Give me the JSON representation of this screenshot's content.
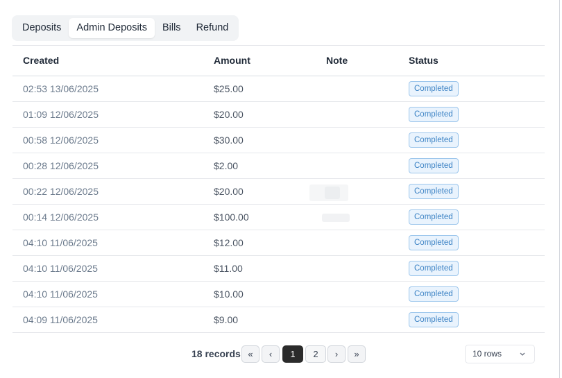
{
  "tabs": [
    {
      "label": "Deposits",
      "active": false
    },
    {
      "label": "Admin Deposits",
      "active": true
    },
    {
      "label": "Bills",
      "active": false
    },
    {
      "label": "Refund",
      "active": false
    }
  ],
  "table": {
    "headers": {
      "created": "Created",
      "amount": "Amount",
      "note": "Note",
      "status": "Status"
    },
    "rows": [
      {
        "created": "02:53 13/06/2025",
        "amount": "$25.00",
        "note": "",
        "status": "Completed"
      },
      {
        "created": "01:09 12/06/2025",
        "amount": "$20.00",
        "note": "",
        "status": "Completed"
      },
      {
        "created": "00:58 12/06/2025",
        "amount": "$30.00",
        "note": "",
        "status": "Completed"
      },
      {
        "created": "00:28 12/06/2025",
        "amount": "$2.00",
        "note": "",
        "status": "Completed"
      },
      {
        "created": "00:22 12/06/2025",
        "amount": "$20.00",
        "note": "",
        "status": "Completed"
      },
      {
        "created": "00:14 12/06/2025",
        "amount": "$100.00",
        "note": "",
        "status": "Completed"
      },
      {
        "created": "04:10 11/06/2025",
        "amount": "$12.00",
        "note": "",
        "status": "Completed"
      },
      {
        "created": "04:10 11/06/2025",
        "amount": "$11.00",
        "note": "",
        "status": "Completed"
      },
      {
        "created": "04:10 11/06/2025",
        "amount": "$10.00",
        "note": "",
        "status": "Completed"
      },
      {
        "created": "04:09 11/06/2025",
        "amount": "$9.00",
        "note": "",
        "status": "Completed"
      }
    ]
  },
  "pagination": {
    "records": "18 records",
    "first_icon": "«",
    "prev_icon": "‹",
    "pages": [
      "1",
      "2"
    ],
    "current_page": "1",
    "next_icon": "›",
    "last_icon": "»"
  },
  "rows_per_page": {
    "value": "10 rows",
    "chevron_icon": "chevron-down-icon"
  },
  "colors": {
    "badge_text": "#3b82c4",
    "badge_bg": "#e9f3fd",
    "active_page": "#2b2b2b"
  }
}
